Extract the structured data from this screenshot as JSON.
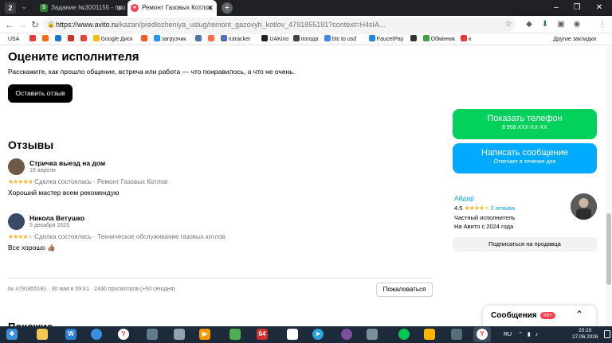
{
  "browser": {
    "tab_count": "2",
    "tabs": [
      {
        "label": "Задание №3001155 - про"
      },
      {
        "label": "Ремонт Газовых Котлов"
      }
    ],
    "url_host": "https://www.avito.ru",
    "url_path": "/kazan/predlozheniya_uslug/remont_gazovyh_kotlov_4791855191?context=H4sIA..."
  },
  "bookmarks": [
    {
      "label": "USA",
      "color": "#3367d6"
    },
    {
      "label": "",
      "color": "#e53935"
    },
    {
      "label": "",
      "color": "#ff6d00"
    },
    {
      "label": "",
      "color": "#1976d2"
    },
    {
      "label": "",
      "color": "#d32f2f"
    },
    {
      "label": "",
      "color": "#ea4335"
    },
    {
      "label": "Google Диск",
      "color": "#fbbc04"
    },
    {
      "label": "",
      "color": "#ff5722"
    },
    {
      "label": "загрузчик",
      "color": "#2196f3"
    },
    {
      "label": "",
      "color": "#4a76a8"
    },
    {
      "label": "",
      "color": "#ff7043"
    },
    {
      "label": "rutracker",
      "color": "#5c6bc0"
    },
    {
      "label": "UAKino",
      "color": "#212121"
    },
    {
      "label": "погода",
      "color": "#424242"
    },
    {
      "label": "btc to usd",
      "color": "#4285f4"
    },
    {
      "label": "FaucetPay",
      "color": "#1e88e5"
    },
    {
      "label": "",
      "color": "#333"
    },
    {
      "label": "Обмінник",
      "color": "#43a047"
    },
    {
      "label": "к",
      "color": "#e53935"
    }
  ],
  "bookmarks_other": "Другие закладки",
  "page": {
    "rate_title": "Оцените исполнителя",
    "rate_sub": "Расскажите, как прошло общение, встреча или работа — что понравилось, а что не очень.",
    "leave_review": "Оставить отзыв",
    "reviews_title": "Отзывы",
    "reviews": [
      {
        "author": "Стричка выезд на дом",
        "date": "19 апреля",
        "rating": 5,
        "deal": "Сделка состоялась · Ремонт Газовых Котлов",
        "text": "Хороший мастер всем рекомендую",
        "avatar_color": "#6d5a48"
      },
      {
        "author": "Никола Ветушко",
        "date": "5 декабря 2025",
        "rating": 4,
        "deal": "Сделка состоялась · Техническое обслуживание газовых котлов",
        "text": "Все хорошо 👍🏽",
        "avatar_color": "#3a4a66"
      }
    ],
    "meta": "№ 4791855191 · 30 мая в 09:41 · 2430 просмотров (+50 сегодня)",
    "report": "Пожаловаться",
    "next_heading": "Похожие объявления"
  },
  "sidebar": {
    "call_label": "Показать телефон",
    "call_phone": "8 958 XXX-XX-XX",
    "msg_label": "Написать сообщение",
    "msg_sub": "Отвечает в течение дня",
    "seller_name": "Айдар",
    "seller_score": "4.5",
    "seller_reviews": "2 отзыва",
    "seller_type": "Частный исполнитель",
    "seller_since": "На Авито с 2024 года",
    "subscribe": "Подписаться на продавца"
  },
  "messenger": {
    "label": "Сообщения",
    "badge": "99+"
  },
  "taskbar": {
    "lang": "RU",
    "time": "20:20",
    "date": "27.06.2026"
  },
  "colors": {
    "call_green": "#02d15c",
    "msg_blue": "#00aaff",
    "star": "#ffb021",
    "link": "#0099f7"
  }
}
